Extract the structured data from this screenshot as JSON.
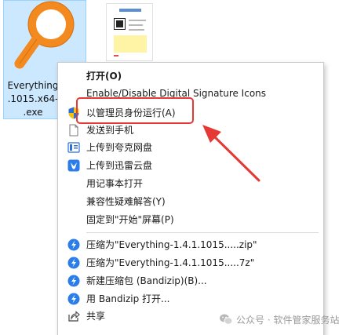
{
  "desktop": {
    "exe_file": {
      "label_lines": [
        "Everything",
        ".1015.x64-",
        ".exe"
      ],
      "icon": "magnifier-icon"
    },
    "thumb_file": {
      "icon": "image-thumbnail-icon"
    }
  },
  "context_menu": {
    "items": [
      {
        "label": "打开(O)",
        "icon": "",
        "bold": true
      },
      {
        "label": "Enable/Disable Digital Signature Icons",
        "icon": ""
      },
      {
        "label": "以管理员身份运行(A)",
        "icon": "uac-shield-icon",
        "highlighted": true
      },
      {
        "label": "发送到手机",
        "icon": "document-icon"
      },
      {
        "label": "上传到夸克网盘",
        "icon": "quark-cloud-icon"
      },
      {
        "label": "上传到迅雷云盘",
        "icon": "thunder-cloud-icon"
      },
      {
        "label": "用记事本打开",
        "icon": ""
      },
      {
        "label": "兼容性疑难解答(Y)",
        "icon": ""
      },
      {
        "label": "固定到\"开始\"屏幕(P)",
        "icon": ""
      },
      {
        "label": "压缩为\"Everything-1.4.1.1015.....zip\"",
        "icon": "bandizip-icon"
      },
      {
        "label": "压缩为\"Everything-1.4.1.1015.....7z\"",
        "icon": "bandizip-icon"
      },
      {
        "label": "新建压缩包 (Bandizip)(B)...",
        "icon": "bandizip-icon"
      },
      {
        "label": "用 Bandizip 打开...",
        "icon": "bandizip-icon"
      },
      {
        "label": "共享",
        "icon": "share-icon"
      }
    ]
  },
  "annotation": {
    "color": "#e53935"
  },
  "watermark": {
    "text": "公众号 · 软件管家服务站",
    "icon": "wechat-icon"
  },
  "colors": {
    "selection": "#cce8ff",
    "accent": "#0078d4",
    "icon_orange": "#f28a1f"
  }
}
